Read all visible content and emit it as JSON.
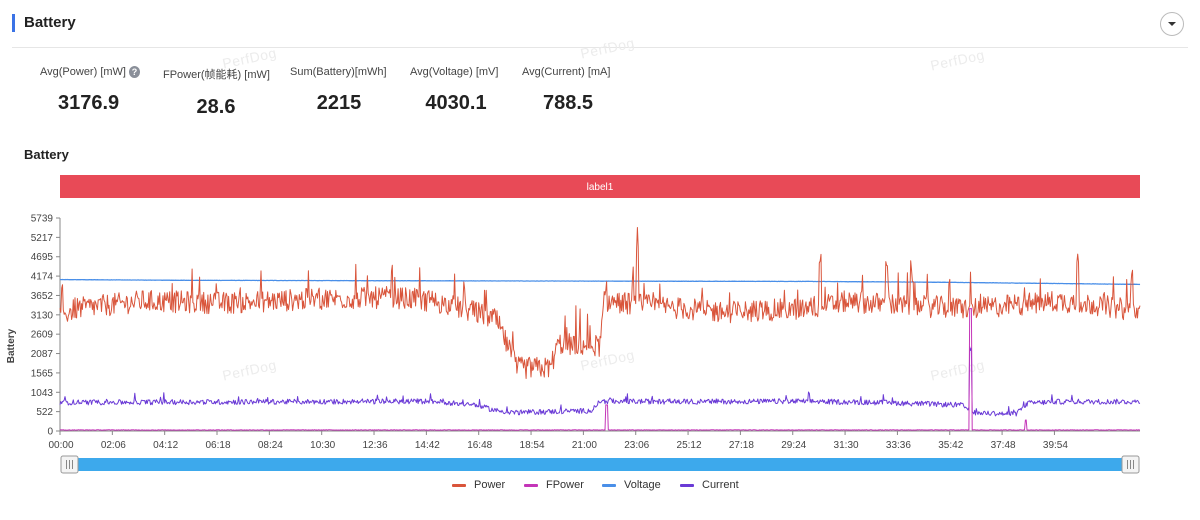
{
  "panel": {
    "title": "Battery",
    "watermark": "PerfDog"
  },
  "metrics": [
    {
      "label": "Avg(Power) [mW]",
      "value": "3176.9",
      "help": true
    },
    {
      "label": "FPower(帧能耗) [mW]",
      "value": "28.6"
    },
    {
      "label": "Sum(Battery)[mWh]",
      "value": "2215"
    },
    {
      "label": "Avg(Voltage) [mV]",
      "value": "4030.1"
    },
    {
      "label": "Avg(Current) [mA]",
      "value": "788.5"
    }
  ],
  "chart_title": "Battery",
  "label_band": "label1",
  "colors": {
    "power": "#d9553b",
    "fpower": "#c435b8",
    "voltage": "#4a8fe8",
    "current": "#6a3ad6",
    "band": "#e84a57",
    "slider": "#3da9ec"
  },
  "chart_data": {
    "type": "line",
    "ylabel": "Battery",
    "ylim": [
      0,
      5739
    ],
    "yticks": [
      "0",
      "522",
      "1043",
      "1565",
      "2087",
      "2609",
      "3130",
      "3652",
      "4174",
      "4695",
      "5217",
      "5739"
    ],
    "xticks": [
      "00:00",
      "02:06",
      "04:12",
      "06:18",
      "08:24",
      "10:30",
      "12:36",
      "14:42",
      "16:48",
      "18:54",
      "21:00",
      "23:06",
      "25:12",
      "27:18",
      "29:24",
      "31:30",
      "33:36",
      "35:42",
      "37:48",
      "39:54"
    ],
    "duration_seconds": 2600,
    "series": [
      {
        "name": "Power",
        "key": "power",
        "anchors": [
          [
            0,
            3100
          ],
          [
            40,
            3300
          ],
          [
            200,
            3500
          ],
          [
            400,
            3450
          ],
          [
            600,
            3550
          ],
          [
            800,
            3600
          ],
          [
            900,
            3500
          ],
          [
            1000,
            3200
          ],
          [
            1050,
            3000
          ],
          [
            1100,
            1700
          ],
          [
            1180,
            1700
          ],
          [
            1200,
            2350
          ],
          [
            1300,
            2300
          ],
          [
            1310,
            3500
          ],
          [
            1400,
            3400
          ],
          [
            1600,
            3200
          ],
          [
            1800,
            3300
          ],
          [
            1900,
            3500
          ],
          [
            2000,
            3400
          ],
          [
            2200,
            3300
          ],
          [
            2400,
            3500
          ],
          [
            2500,
            3400
          ],
          [
            2600,
            3200
          ]
        ],
        "spikes": [
          [
            1390,
            5200
          ],
          [
            1830,
            4700
          ],
          [
            1990,
            4700
          ],
          [
            2050,
            4300
          ],
          [
            2320,
            3600
          ],
          [
            2450,
            4600
          ],
          [
            2580,
            4200
          ]
        ]
      },
      {
        "name": "FPower",
        "key": "fpower",
        "anchors": [
          [
            0,
            28
          ],
          [
            2600,
            28
          ]
        ]
      },
      {
        "name": "Voltage",
        "key": "voltage",
        "anchors": [
          [
            0,
            4080
          ],
          [
            300,
            4060
          ],
          [
            1200,
            4040
          ],
          [
            1800,
            4030
          ],
          [
            2100,
            4010
          ],
          [
            2600,
            3950
          ]
        ]
      },
      {
        "name": "Current",
        "key": "current",
        "anchors": [
          [
            0,
            770
          ],
          [
            900,
            800
          ],
          [
            1000,
            700
          ],
          [
            1050,
            550
          ],
          [
            1100,
            500
          ],
          [
            1280,
            550
          ],
          [
            1300,
            800
          ],
          [
            1500,
            790
          ],
          [
            1800,
            800
          ],
          [
            2000,
            760
          ],
          [
            2170,
            700
          ],
          [
            2200,
            500
          ],
          [
            2300,
            450
          ],
          [
            2330,
            750
          ],
          [
            2400,
            790
          ],
          [
            2600,
            790
          ]
        ]
      }
    ]
  },
  "legend": [
    {
      "name": "Power",
      "key": "power"
    },
    {
      "name": "FPower",
      "key": "fpower"
    },
    {
      "name": "Voltage",
      "key": "voltage"
    },
    {
      "name": "Current",
      "key": "current"
    }
  ]
}
